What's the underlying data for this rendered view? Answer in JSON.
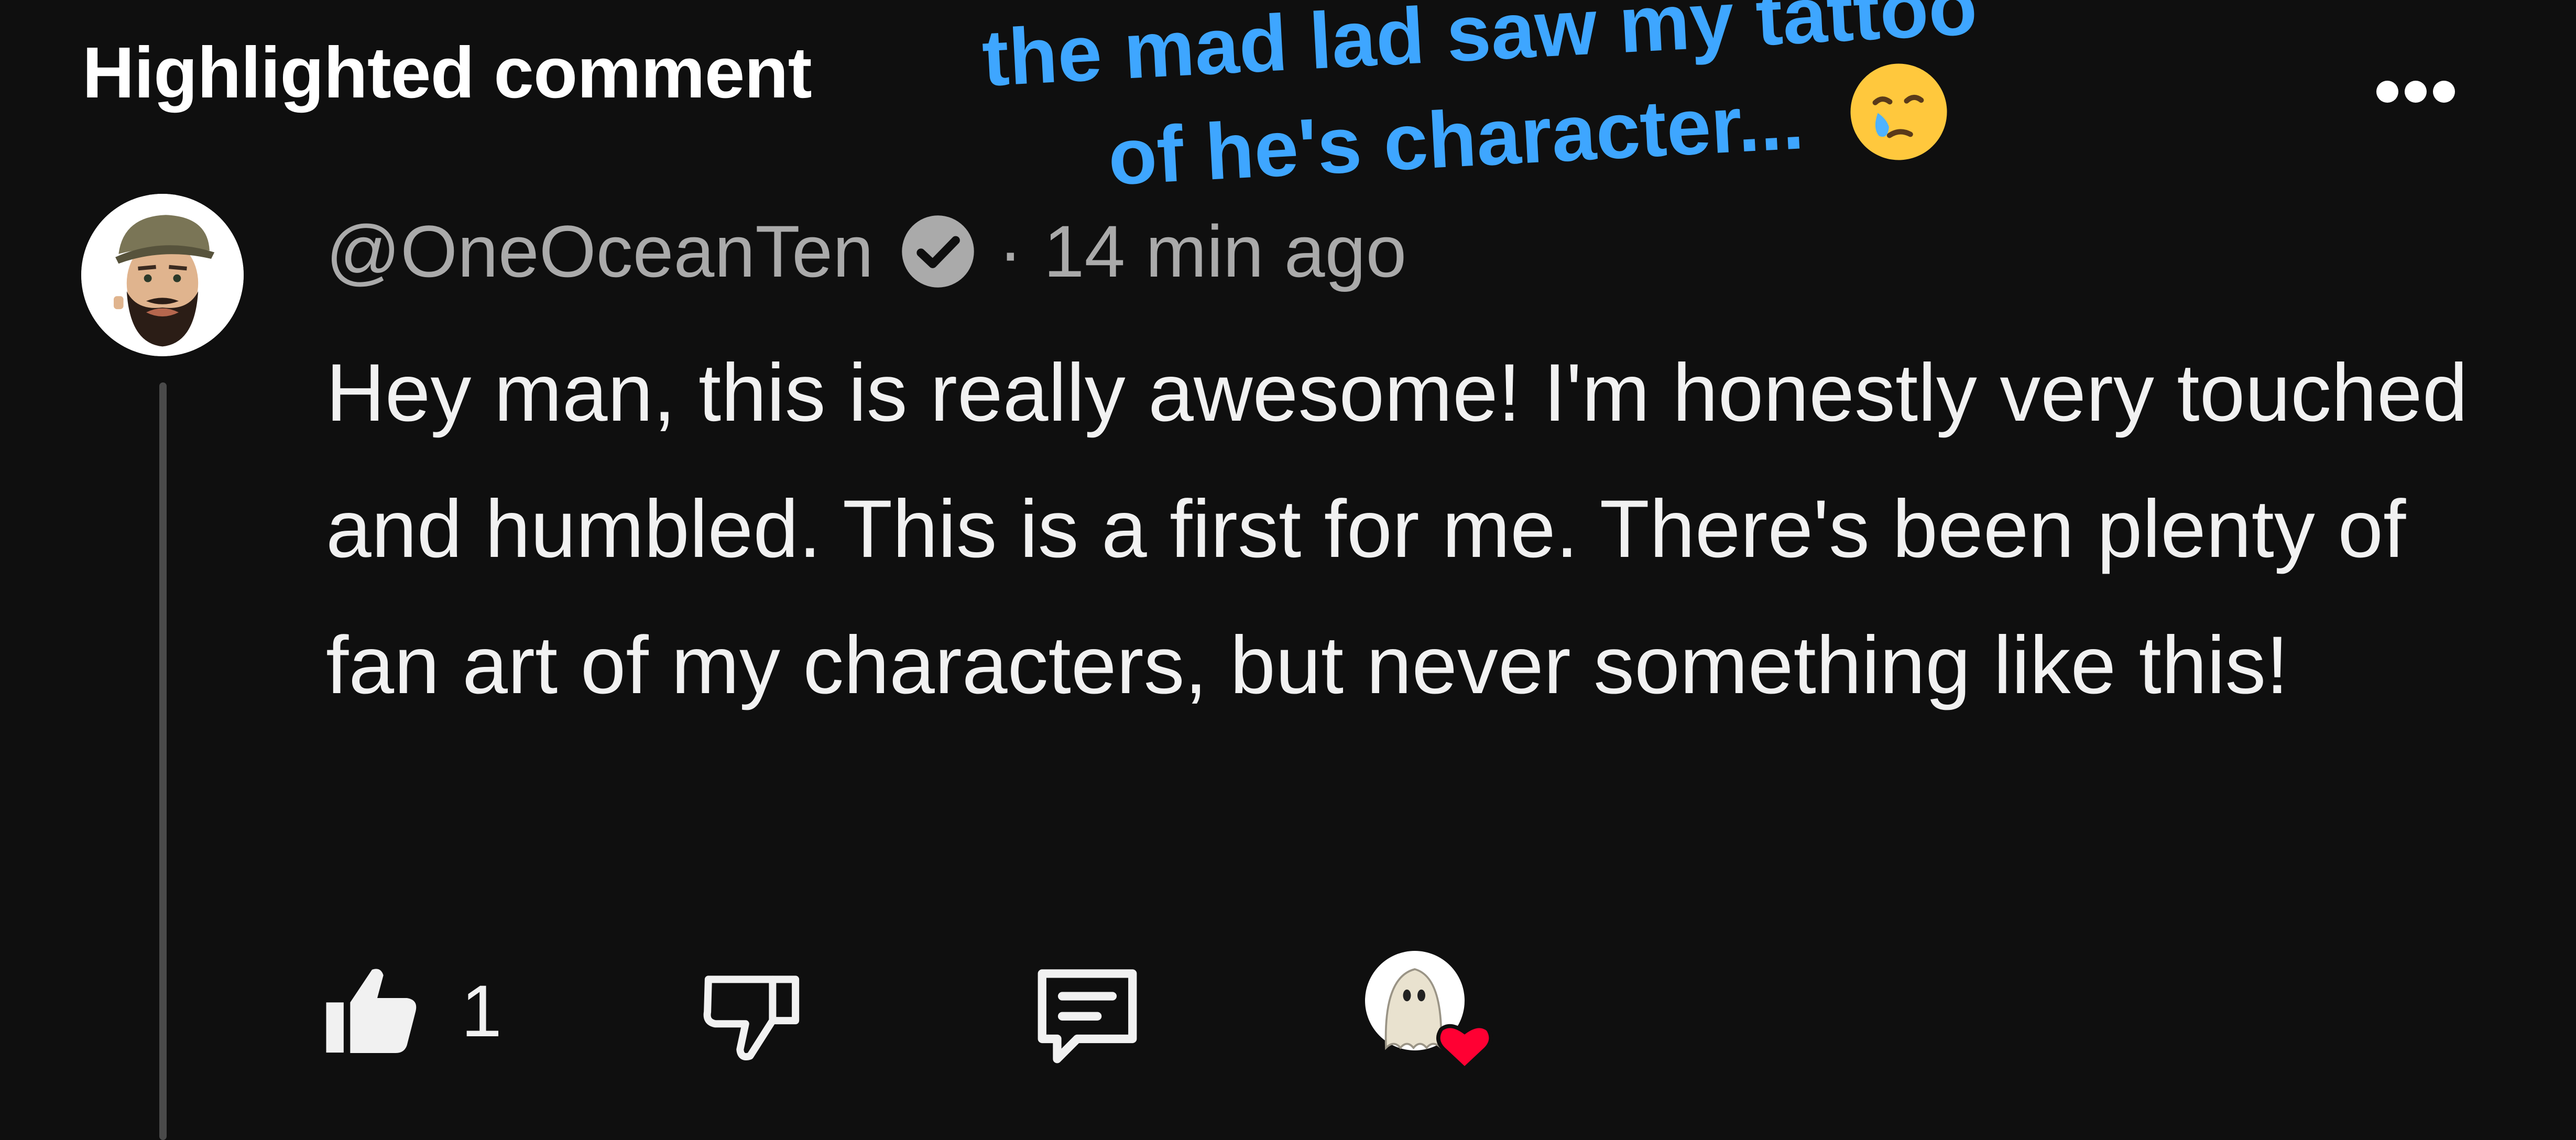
{
  "header": {
    "title": "Highlighted comment"
  },
  "overlay_caption": {
    "line1": "the mad lad saw my tattoo",
    "line2": "of he's character...",
    "emoji": "face-holding-back-tears"
  },
  "comment": {
    "author": "@OneOceanTen",
    "verified": true,
    "separator": "·",
    "timestamp": "14 min ago",
    "text": "Hey man, this is really awesome! I'm honestly very touched and humbled. This is a first for me. There's been plenty of fan art of my characters, but never something like this!",
    "like_count": "1"
  },
  "icons": {
    "more": "more-horizontal-icon",
    "verified": "verified-check-icon",
    "like": "thumbs-up-filled-icon",
    "dislike": "thumbs-down-outline-icon",
    "reply": "reply-comment-icon",
    "creator_heart": "creator-heart-icon"
  },
  "colors": {
    "background": "#0f0f0f",
    "caption": "#3ea6ff",
    "heart": "#ff0033"
  }
}
